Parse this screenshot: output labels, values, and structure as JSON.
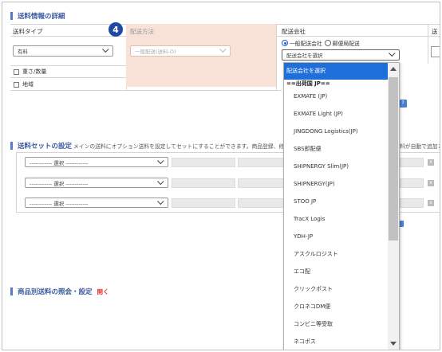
{
  "section1": {
    "title": "送料情報の詳細"
  },
  "columns": {
    "shipping_type": "送料タイプ",
    "delivery_method": "配送方法",
    "carrier": "配送会社",
    "partial": "送"
  },
  "step_badge": "4",
  "shipping_type_select": {
    "value": "有料"
  },
  "delivery_method_select": {
    "value": "一般配送(送料-O)"
  },
  "carrier_radio": {
    "option1": "一般配送会社",
    "option2": "郵便局配送"
  },
  "carrier_select": {
    "value": "配送会社を選択"
  },
  "checkboxes": {
    "weight": "重さ/数量",
    "region": "地域"
  },
  "section2": {
    "title": "送料セットの設定",
    "desc": "メインの送料にオプション送料を設定してセットにすることができます。商品登録、修正ペー",
    "desc_tail": "料が自動で追加さ"
  },
  "set_rows": [
    {
      "value": "------------ 選択 ------------"
    },
    {
      "value": "------------ 選択 ------------"
    },
    {
      "value": "------------ 選択 ------------"
    }
  ],
  "section3": {
    "title": "商品別送料の照会・設定",
    "link": "開く"
  },
  "dropdown": {
    "selected": "配送会社を選択",
    "group": "==出荷国 JP==",
    "options": [
      "EXMATE (JP)",
      "EXMATE Light (JP)",
      "JINGDONG Logistics(JP)",
      "SBS即配便",
      "SHIPNERGY Slim(JP)",
      "SHIPNERGY(JP)",
      "STOO JP",
      "TracX Logis",
      "YDH-JP",
      "アスクルロジスト",
      "エコ配",
      "クリックポスト",
      "クロネコDM便",
      "コンビニ等受取",
      "ネコポス"
    ]
  },
  "colors": {
    "accent": "#1e6fd9",
    "highlight": "#f8e1d6",
    "title": "#3a5a9e",
    "link": "#e03a3a"
  }
}
